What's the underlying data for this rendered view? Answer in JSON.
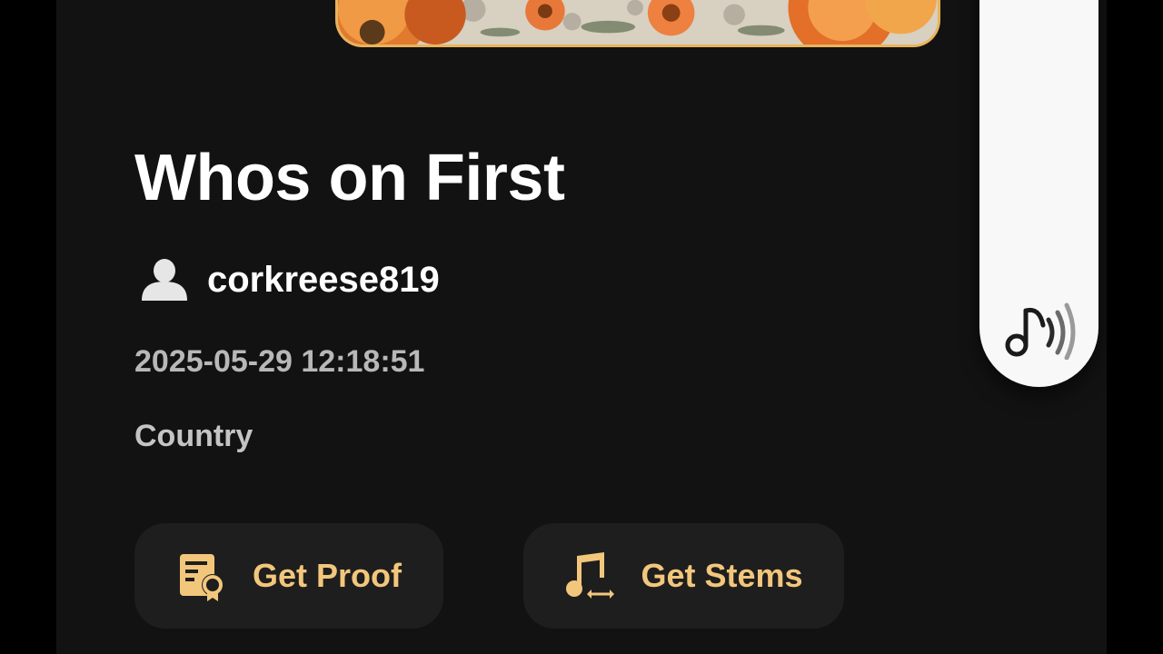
{
  "song": {
    "title": "Whos on First",
    "author": "corkreese819",
    "created_at": "2025-05-29 12:18:51",
    "genre": "Country"
  },
  "actions": {
    "get_proof_label": "Get Proof",
    "get_stems_label": "Get Stems"
  },
  "icons": {
    "author": "user-icon",
    "sound": "music-note-sound-icon",
    "proof": "certificate-document-icon",
    "stems": "music-note-arrows-icon"
  },
  "colors": {
    "background": "#000000",
    "panel": "#121212",
    "button_bg": "#1f1e1e",
    "accent": "#f2c77c",
    "artwork_border": "#e9b35b",
    "side_tab": "#f8f8f8"
  }
}
